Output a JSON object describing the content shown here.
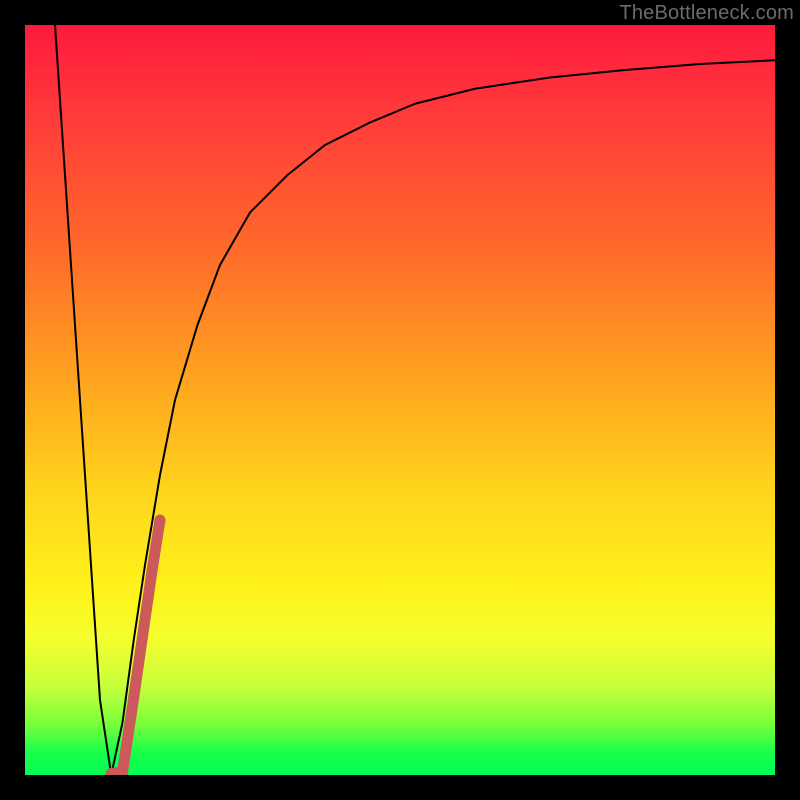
{
  "watermark": "TheBottleneck.com",
  "chart_data": {
    "type": "line",
    "title": "",
    "xlabel": "",
    "ylabel": "",
    "xlim": [
      0,
      100
    ],
    "ylim": [
      0,
      100
    ],
    "series": [
      {
        "name": "black-curve",
        "stroke": "#000000",
        "stroke_width": 2,
        "x": [
          4,
          6,
          8,
          10,
          11.5,
          13,
          14.5,
          16,
          18,
          20,
          23,
          26,
          30,
          35,
          40,
          46,
          52,
          60,
          70,
          80,
          90,
          100
        ],
        "y": [
          100,
          70,
          40,
          10,
          0,
          7,
          18,
          28,
          40,
          50,
          60,
          68,
          75,
          80,
          84,
          87,
          89.5,
          91.5,
          93,
          94,
          94.8,
          95.3
        ]
      },
      {
        "name": "highlight-segment",
        "stroke": "#cc5a5a",
        "stroke_width": 11,
        "x": [
          11.5,
          13.0,
          14.3,
          15.6,
          16.9,
          18.0
        ],
        "y": [
          0.2,
          0.4,
          9.0,
          18.0,
          27.0,
          34.0
        ]
      }
    ]
  }
}
